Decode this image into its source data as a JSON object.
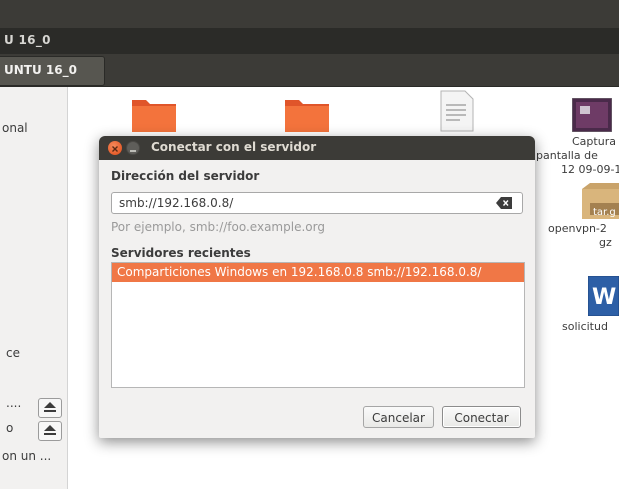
{
  "window": {
    "title": "U 16_0",
    "path_button": "UNTU 16_0"
  },
  "sidebar": {
    "items": [
      {
        "label": "onal"
      },
      {
        "label": "ce"
      },
      {
        "label": "...."
      },
      {
        "label": "o"
      },
      {
        "label": "on un ..."
      }
    ]
  },
  "files": [
    {
      "label": "Captura"
    },
    {
      "label": "pantalla de"
    },
    {
      "label": "12 09-09-1"
    },
    {
      "label": "tar.g"
    },
    {
      "label": "openvpn-2"
    },
    {
      "label": "gz"
    },
    {
      "label": "W"
    },
    {
      "label": "solicitud"
    }
  ],
  "dialog": {
    "title": "Conectar con el servidor",
    "address_label": "Dirección del servidor",
    "address_value": "smb://192.168.0.8/",
    "hint": "Por ejemplo, smb://foo.example.org",
    "recent_label": "Servidores recientes",
    "recent_items": [
      {
        "label": "Comparticiones Windows en 192.168.0.8  smb://192.168.0.8/"
      }
    ],
    "cancel_label": "Cancelar",
    "connect_label": "Conectar"
  },
  "colors": {
    "accent": "#f07746",
    "titlebar": "#3c3b37",
    "close": "#df4a16"
  }
}
